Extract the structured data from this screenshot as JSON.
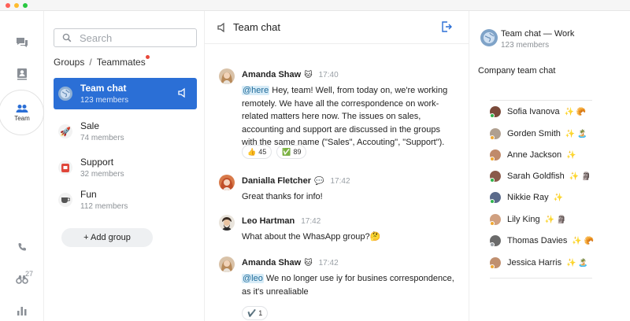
{
  "rail": {
    "team_label": "Team",
    "calls_badge": "27"
  },
  "groups_panel": {
    "search_placeholder": "Search",
    "breadcrumb_groups": "Groups",
    "breadcrumb_sep": "/",
    "breadcrumb_teammates": "Teammates",
    "groups": [
      {
        "name": "Team chat",
        "members": "123 members",
        "icon": "globe-icon"
      },
      {
        "name": "Sale",
        "members": "74 members",
        "icon": "rocket-icon"
      },
      {
        "name": "Support",
        "members": "32 members",
        "icon": "life-ring-icon"
      },
      {
        "name": "Fun",
        "members": "112 members",
        "icon": "coffee-icon"
      }
    ],
    "add_group_label": "+ Add group"
  },
  "chat": {
    "title": "Team chat",
    "messages": [
      {
        "author": "Amanda Shaw",
        "emoji": "🐱",
        "time": "17:40",
        "mention": "@here",
        "text": " Hey, team! Well, from today on, we're working remotely. We have all the correspondence on work-related matters here now. The issues on sales, accounting and support are discussed in the groups with the same name (\"Sales\", Accouting\", \"Support\").",
        "reactions": [
          {
            "emoji": "👍",
            "count": "45"
          },
          {
            "emoji": "✅",
            "count": "89"
          }
        ]
      },
      {
        "author": "Danialla Fletcher",
        "emoji": "💬",
        "time": "17:42",
        "text": "Great thanks for info!"
      },
      {
        "author": "Leo Hartman",
        "time": "17:42",
        "text": "What about the WhasApp group?🤔"
      },
      {
        "author": "Amanda Shaw",
        "emoji": "🐱",
        "time": "17:42",
        "mention": "@leo",
        "text": " We no longer use iy for busines correspondence, as it's unrealiable",
        "reactions": [
          {
            "emoji": "✔️",
            "count": "1"
          }
        ]
      }
    ]
  },
  "info": {
    "title": "Team chat — Work",
    "members": "123 members",
    "description": "Company team chat",
    "people": [
      {
        "name": "Sofia Ivanova",
        "emojis": "✨ 🥐",
        "status": "#2fb34a"
      },
      {
        "name": "Gorden Smith",
        "emojis": "✨ 🏝️",
        "status": "#f0a830"
      },
      {
        "name": "Anne Jackson",
        "emojis": "✨",
        "status": "#f0a830"
      },
      {
        "name": "Sarah Goldfish",
        "emojis": "✨ 🗿",
        "status": "#2fb34a"
      },
      {
        "name": "Nikkie Ray",
        "emojis": "✨",
        "status": "#2fb34a"
      },
      {
        "name": "Lily King",
        "emojis": "✨ 🗿",
        "status": "#f0a830"
      },
      {
        "name": "Thomas Davies",
        "emojis": "✨ 🥐",
        "status": "#9aa0a6"
      },
      {
        "name": "Jessica Harris",
        "emojis": "✨ 🏝️",
        "status": "#f0a830"
      }
    ]
  },
  "colors": {
    "accent": "#2b6fd6",
    "mention_bg": "#d8ecf7",
    "online": "#2fb34a",
    "away": "#f0a830"
  }
}
